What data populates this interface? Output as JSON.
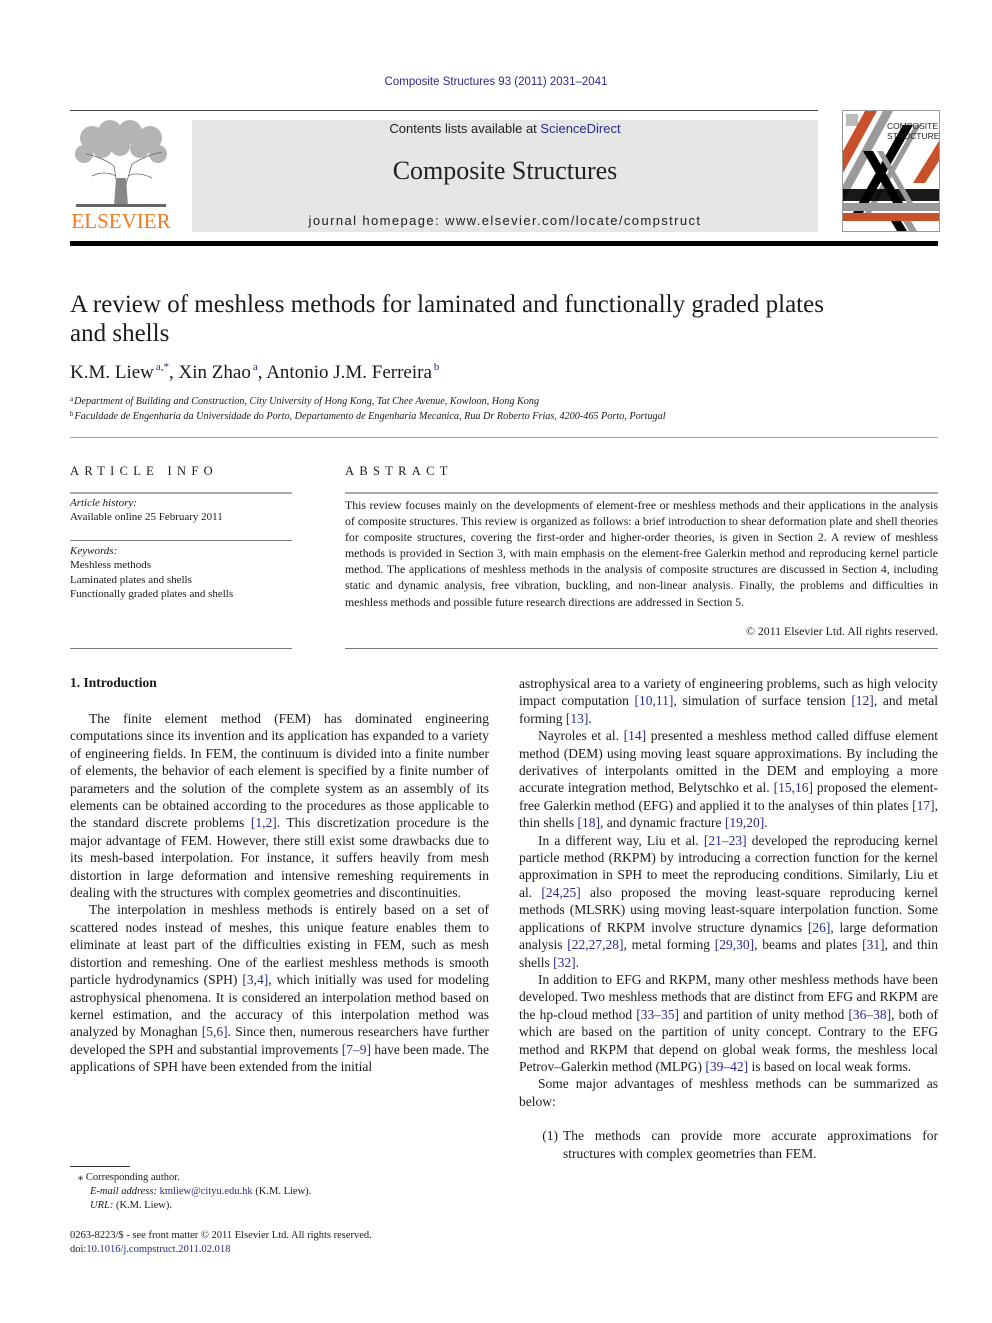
{
  "header": {
    "running_head": "Composite Structures 93 (2011) 2031–2041",
    "contents_prefix": "Contents lists available at ",
    "contents_link": "ScienceDirect",
    "journal_name": "Composite Structures",
    "homepage": "journal homepage: www.elsevier.com/locate/compstruct",
    "publisher_logo_text": "ELSEVIER",
    "cover_title_line1": "COMPOSITE",
    "cover_title_line2": "STRUCTURES"
  },
  "colors": {
    "link": "#2a2a8a",
    "elsevier_orange": "#f47920",
    "cover_orange": "#c8502a",
    "cover_gray": "#9a9a9a",
    "banner_bg": "#e6e6e6"
  },
  "article": {
    "title_line1": "A review of meshless methods for laminated and functionally graded plates",
    "title_line2": "and shells",
    "authors": [
      {
        "name": "K.M. Liew",
        "sup": "a,*",
        "sep": ", "
      },
      {
        "name": "Xin Zhao",
        "sup": "a",
        "sep": ", "
      },
      {
        "name": "Antonio J.M. Ferreira",
        "sup": "b",
        "sep": ""
      }
    ],
    "affiliations": [
      {
        "sup": "a",
        "text": "Department of Building and Construction, City University of Hong Kong, Tat Chee Avenue, Kowloon, Hong Kong"
      },
      {
        "sup": "b",
        "text": "Faculdade de Engenharia da Universidade do Porto, Departamento de Engenharia Mecanica, Rua Dr Roberto Frias, 4200-465 Porto, Portugal"
      }
    ]
  },
  "article_info": {
    "heading": "ARTICLE INFO",
    "history_label": "Article history:",
    "history_value": "Available online 25 February 2011",
    "keywords_label": "Keywords:",
    "keywords": [
      "Meshless methods",
      "Laminated plates and shells",
      "Functionally graded plates and shells"
    ]
  },
  "abstract": {
    "heading": "ABSTRACT",
    "text": "This review focuses mainly on the developments of element-free or meshless methods and their applications in the analysis of composite structures. This review is organized as follows: a brief introduction to shear deformation plate and shell theories for composite structures, covering the first-order and higher-order theories, is given in Section 2. A review of meshless methods is provided in Section 3, with main emphasis on the element-free Galerkin method and reproducing kernel particle method. The applications of meshless methods in the analysis of composite structures are discussed in Section 4, including static and dynamic analysis, free vibration, buckling, and non-linear analysis. Finally, the problems and difficulties in meshless methods and possible future research directions are addressed in Section 5.",
    "copyright": "© 2011 Elsevier Ltd. All rights reserved."
  },
  "section1": {
    "heading": "1. Introduction",
    "left_paragraphs": [
      [
        {
          "t": "The finite element method (FEM) has dominated engineering computations since its invention and its application has expanded to a variety of engineering fields. In FEM, the continuum is divided into a finite number of elements, the behavior of each element is specified by a finite number of parameters and the solution of the complete system as an assembly of its elements can be obtained according to the procedures as those applicable to the standard discrete problems "
        },
        {
          "ref": "[1,2]"
        },
        {
          "t": ". This discretization procedure is the major advantage of FEM. However, there still exist some drawbacks due to its mesh-based interpolation. For instance, it suffers heavily from mesh distortion in large deformation and intensive remeshing requirements in dealing with the structures with complex geometries and discontinuities."
        }
      ],
      [
        {
          "t": "The interpolation in meshless methods is entirely based on a set of scattered nodes instead of meshes, this unique feature enables them to eliminate at least part of the difficulties existing in FEM, such as mesh distortion and remeshing. One of the earliest meshless methods is smooth particle hydrodynamics (SPH) "
        },
        {
          "ref": "[3,4]"
        },
        {
          "t": ", which initially was used for modeling astrophysical phenomena. It is considered an interpolation method based on kernel estimation, and the accuracy of this interpolation method was analyzed by Monaghan "
        },
        {
          "ref": "[5,6]"
        },
        {
          "t": ". Since then, numerous researchers have further developed the SPH and substantial improvements "
        },
        {
          "ref": "[7–9]"
        },
        {
          "t": " have been made. The applications of SPH have been extended from the initial"
        }
      ]
    ],
    "right_paragraphs": [
      {
        "indent": false,
        "runs": [
          {
            "t": "astrophysical area to a variety of engineering problems, such as high velocity impact computation "
          },
          {
            "ref": "[10,11]"
          },
          {
            "t": ", simulation of surface tension "
          },
          {
            "ref": "[12]"
          },
          {
            "t": ", and metal forming "
          },
          {
            "ref": "[13]"
          },
          {
            "t": "."
          }
        ]
      },
      {
        "indent": true,
        "runs": [
          {
            "t": "Nayroles et al. "
          },
          {
            "ref": "[14]"
          },
          {
            "t": " presented a meshless method called diffuse element method (DEM) using moving least square approximations. By including the derivatives of interpolants omitted in the DEM and employing a more accurate integration method, Belytschko et al. "
          },
          {
            "ref": "[15,16]"
          },
          {
            "t": " proposed the element-free Galerkin method (EFG) and applied it to the analyses of thin plates "
          },
          {
            "ref": "[17]"
          },
          {
            "t": ", thin shells "
          },
          {
            "ref": "[18]"
          },
          {
            "t": ", and dynamic fracture "
          },
          {
            "ref": "[19,20]"
          },
          {
            "t": "."
          }
        ]
      },
      {
        "indent": true,
        "runs": [
          {
            "t": "In a different way, Liu et al. "
          },
          {
            "ref": "[21–23]"
          },
          {
            "t": " developed the reproducing kernel particle method (RKPM) by introducing a correction function for the kernel approximation in SPH to meet the reproducing conditions. Similarly, Liu et al. "
          },
          {
            "ref": "[24,25]"
          },
          {
            "t": " also proposed the moving least-square reproducing kernel methods (MLSRK) using moving least-square interpolation function. Some applications of RKPM involve structure dynamics "
          },
          {
            "ref": "[26]"
          },
          {
            "t": ", large deformation analysis "
          },
          {
            "ref": "[22,27,28]"
          },
          {
            "t": ", metal forming "
          },
          {
            "ref": "[29,30]"
          },
          {
            "t": ", beams and plates "
          },
          {
            "ref": "[31]"
          },
          {
            "t": ", and thin shells "
          },
          {
            "ref": "[32]"
          },
          {
            "t": "."
          }
        ]
      },
      {
        "indent": true,
        "runs": [
          {
            "t": "In addition to EFG and RKPM, many other meshless methods have been developed. Two meshless methods that are distinct from EFG and RKPM are the hp-cloud method "
          },
          {
            "ref": "[33–35]"
          },
          {
            "t": " and partition of unity method "
          },
          {
            "ref": "[36–38]"
          },
          {
            "t": ", both of which are based on the partition of unity concept. Contrary to the EFG method and RKPM that depend on global weak forms, the meshless local Petrov–Galerkin method (MLPG) "
          },
          {
            "ref": "[39–42]"
          },
          {
            "t": " is based on local weak forms."
          }
        ]
      },
      {
        "indent": true,
        "runs": [
          {
            "t": "Some major advantages of meshless methods can be summarized as below:"
          }
        ]
      }
    ],
    "list": [
      {
        "num": "(1)",
        "text": "The methods can provide more accurate approximations for structures with complex geometries than FEM."
      }
    ]
  },
  "footnotes": {
    "star": "⁎",
    "corresponding": "Corresponding author.",
    "email_label": "E-mail address:",
    "email": "kmliew@cityu.edu.hk",
    "email_suffix": " (K.M. Liew).",
    "url_label": "URL:",
    "url_suffix": "  (K.M. Liew)."
  },
  "front_matter": {
    "issn_line": "0263-8223/$ - see front matter © 2011 Elsevier Ltd. All rights reserved.",
    "doi_prefix": "doi:",
    "doi": "10.1016/j.compstruct.2011.02.018"
  }
}
